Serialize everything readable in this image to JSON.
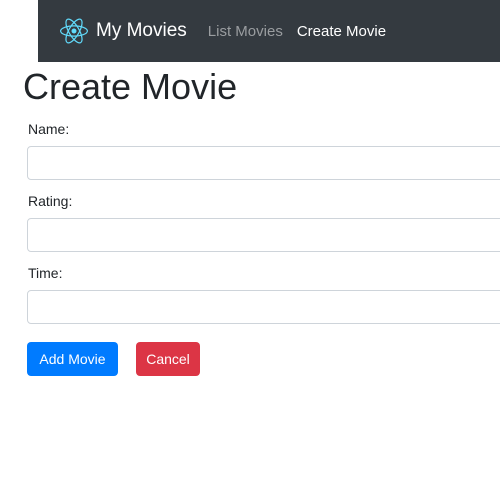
{
  "navbar": {
    "brand_icon": "react-atom-icon",
    "brand": "My Movies",
    "links": [
      {
        "label": "List Movies"
      },
      {
        "label": "Create Movie"
      }
    ],
    "background": "#343a40"
  },
  "page": {
    "title": "Create Movie"
  },
  "form": {
    "fields": [
      {
        "label": "Name:",
        "value": ""
      },
      {
        "label": "Rating:",
        "value": ""
      },
      {
        "label": "Time:",
        "value": ""
      }
    ],
    "submit_label": "Add Movie",
    "cancel_label": "Cancel"
  },
  "colors": {
    "primary": "#007bff",
    "danger": "#dc3545",
    "brand_icon": "#61dafb"
  }
}
